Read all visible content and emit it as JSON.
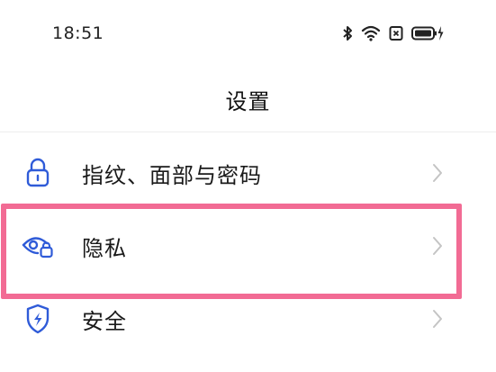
{
  "status_bar": {
    "time": "18:51",
    "icons": [
      "bluetooth-icon",
      "wifi-icon",
      "sim-disabled-icon",
      "battery-charging-icon"
    ]
  },
  "header": {
    "title": "设置"
  },
  "settings": {
    "items": [
      {
        "label": "指纹、面部与密码",
        "icon": "lock-icon"
      },
      {
        "label": "隐私",
        "icon": "privacy-eye-icon"
      },
      {
        "label": "安全",
        "icon": "shield-icon"
      }
    ]
  },
  "colors": {
    "accent_icon": "#2f5bd8",
    "highlight": "#f26b94",
    "chevron": "#c4c4c4"
  }
}
